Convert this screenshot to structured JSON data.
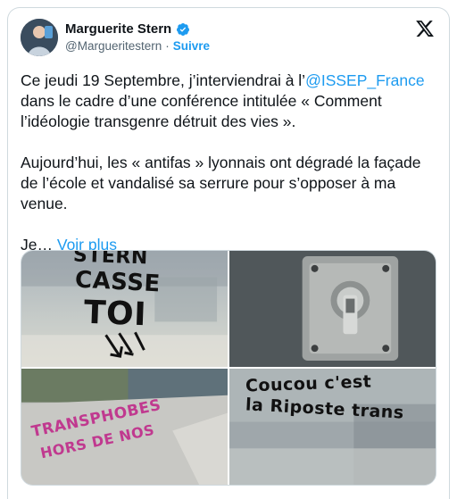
{
  "author": {
    "display_name": "Marguerite Stern",
    "handle": "@Margueritestern",
    "separator": "·",
    "follow_label": "Suivre"
  },
  "icons": {
    "verified": "verified-badge-icon",
    "x_logo": "x-logo-icon"
  },
  "colors": {
    "accent": "#1d9bf0",
    "text": "#0f1419",
    "secondary": "#536471"
  },
  "tweet": {
    "p1_before": "Ce jeudi 19 Septembre, j’interviendrai à l’",
    "mention": "@ISSEP_France",
    "p1_after": " dans le cadre d’une conférence intitulée « Comment l’idéologie transgenre détruit des vies ».",
    "p2": "Aujourd’hui, les « antifas » lyonnais ont dégradé la façade de l’école et vandalisé sa serrure pour s’opposer à ma venue.",
    "p3_start": "Je… ",
    "more_label": "Voir plus"
  },
  "media": {
    "photo1": {
      "line1": "STERN",
      "line2": "CASSE",
      "line3": "TOI"
    },
    "photo3": {
      "line1": "TRANSPHOBES",
      "line2": "HORS DE NOS"
    },
    "photo4": {
      "line1": "Coucou c'est",
      "line2": "la Riposte trans"
    }
  }
}
